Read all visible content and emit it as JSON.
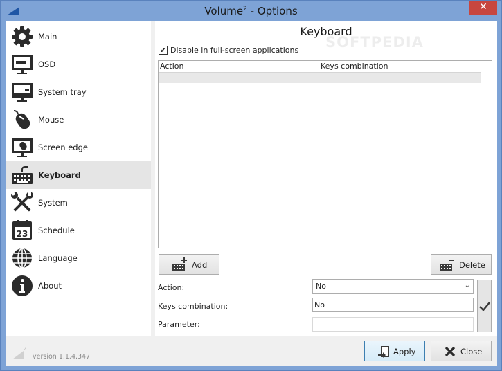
{
  "window": {
    "title": "Volume",
    "title_sup": "2",
    "title_suffix": " - Options",
    "close_glyph": "✕"
  },
  "watermark": "SOFTPEDIA",
  "sidebar": {
    "items": [
      {
        "label": "Main",
        "icon": "gear-icon"
      },
      {
        "label": "OSD",
        "icon": "monitor-icon"
      },
      {
        "label": "System tray",
        "icon": "tray-monitor-icon"
      },
      {
        "label": "Mouse",
        "icon": "mouse-icon"
      },
      {
        "label": "Screen edge",
        "icon": "screen-edge-icon"
      },
      {
        "label": "Keyboard",
        "icon": "keyboard-icon",
        "active": true
      },
      {
        "label": "System",
        "icon": "tools-icon"
      },
      {
        "label": "Schedule",
        "icon": "calendar-icon",
        "calendar_day": "23"
      },
      {
        "label": "Language",
        "icon": "globe-icon"
      },
      {
        "label": "About",
        "icon": "info-icon"
      }
    ]
  },
  "main": {
    "title": "Keyboard",
    "fullscreen_checkbox": {
      "label": "Disable in full-screen applications",
      "checked": true,
      "mark": "✔"
    },
    "table": {
      "columns": [
        "Action",
        "Keys combination"
      ],
      "rows": [
        [
          "",
          ""
        ]
      ]
    },
    "add_label": "Add",
    "delete_label": "Delete",
    "action_label": "Action:",
    "action_value": "No",
    "action_arrow": "⌄",
    "keys_label": "Keys combination:",
    "keys_value": "No",
    "parameter_label": "Parameter:",
    "parameter_value": ""
  },
  "footer": {
    "logo_sup": "2",
    "version": "version 1.1.4.347",
    "apply_label": "Apply",
    "close_label": "Close"
  },
  "colors": {
    "frame": "#7ea3d6",
    "close_button": "#c7463f",
    "selected_nav": "#e5e5e5"
  }
}
